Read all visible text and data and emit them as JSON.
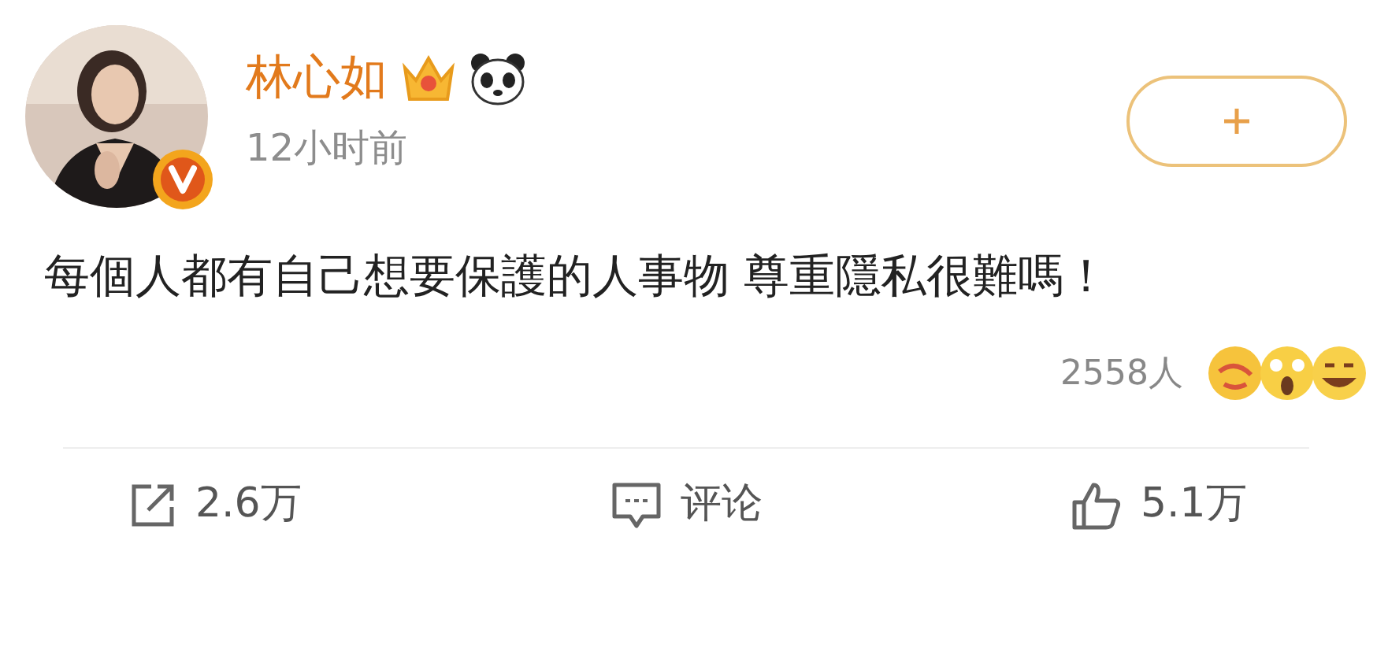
{
  "post": {
    "author": "林心如",
    "time": "12小时前",
    "verified": true,
    "text": "每個人都有自己想要保護的人事物 尊重隱私很難嗎！",
    "reactions": {
      "count": "2558人"
    }
  },
  "actions": [
    {
      "kind": "share",
      "label": "2.6万"
    },
    {
      "kind": "comment",
      "label": "评论"
    },
    {
      "kind": "like",
      "label": "5.1万"
    }
  ]
}
